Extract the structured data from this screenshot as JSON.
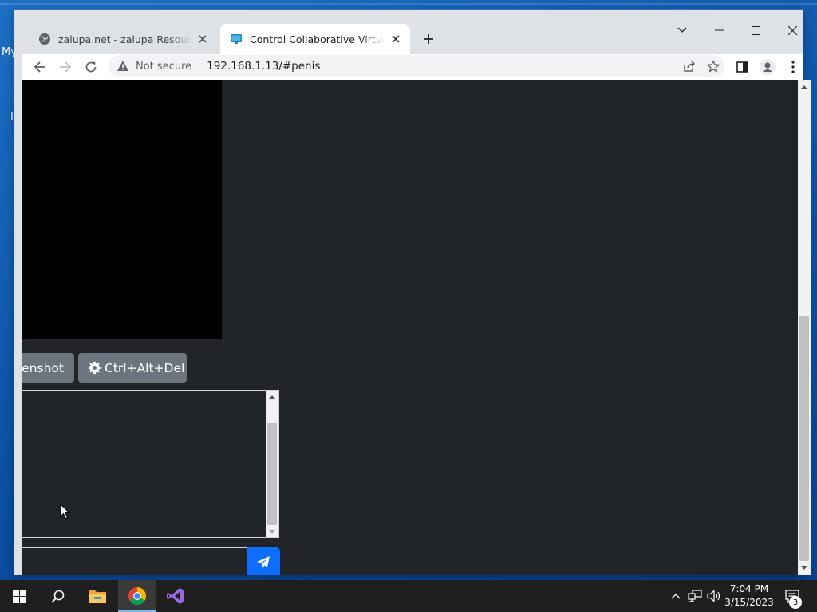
{
  "desktop": {
    "icon_label_fragment": "My",
    "icon_label_fragment2": "I"
  },
  "browser": {
    "tabs": [
      {
        "title": "zalupa.net - zalupa Resources and",
        "icon": "globe-icon"
      },
      {
        "title": "Control Collaborative Virtual Machine",
        "icon": "monitor-icon",
        "active": true
      }
    ],
    "new_tab_icon": "plus-icon",
    "security_label": "Not secure",
    "url": "192.168.1.13/#penis"
  },
  "page": {
    "screenshot_button": "eenshot",
    "ctrl_alt_del_button": "Ctrl+Alt+Del",
    "chat_input_value": "",
    "send_icon": "paper-plane-icon",
    "colors": {
      "background": "#212529",
      "secondary_button": "#6c757d",
      "primary_button": "#0d6efd"
    }
  },
  "taskbar": {
    "pinned": [
      "windows-start-icon",
      "search-icon",
      "file-explorer-icon",
      "chrome-icon",
      "visual-studio-icon"
    ],
    "time": "7:04 PM",
    "date": "3/15/2023",
    "notification_count": "3"
  }
}
